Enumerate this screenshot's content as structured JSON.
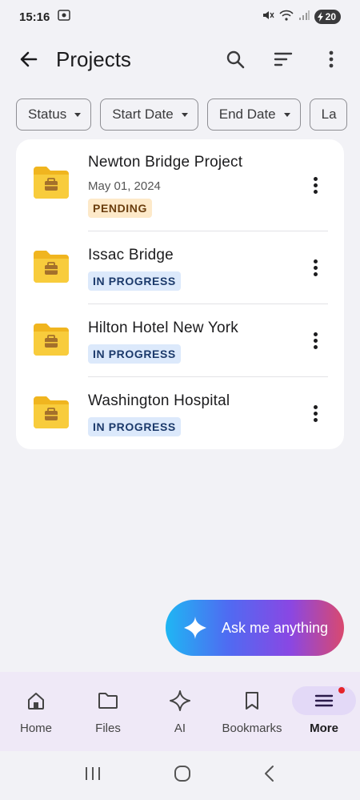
{
  "status_bar": {
    "time": "15:16",
    "battery": "20"
  },
  "header": {
    "title": "Projects"
  },
  "filters": [
    "Status",
    "Start Date",
    "End Date",
    "La"
  ],
  "projects": [
    {
      "name": "Newton Bridge Project",
      "date": "May 01, 2024",
      "status": "PENDING"
    },
    {
      "name": "Issac Bridge",
      "status": "IN PROGRESS"
    },
    {
      "name": "Hilton Hotel New York",
      "status": "IN PROGRESS"
    },
    {
      "name": "Washington Hospital",
      "status": "IN PROGRESS"
    }
  ],
  "ask_button": {
    "label": "Ask me anything"
  },
  "bottom_nav": [
    {
      "label": "Home",
      "icon": "home-icon"
    },
    {
      "label": "Files",
      "icon": "folder-icon"
    },
    {
      "label": "AI",
      "icon": "sparkle-icon"
    },
    {
      "label": "Bookmarks",
      "icon": "bookmark-icon"
    },
    {
      "label": "More",
      "icon": "menu-icon",
      "active": true
    }
  ],
  "colors": {
    "folder": "#f5c431",
    "pending_bg": "#fde9c9",
    "progress_bg": "#dce9fb",
    "nav_bg": "#efe9f7",
    "notification": "#e5242a"
  }
}
